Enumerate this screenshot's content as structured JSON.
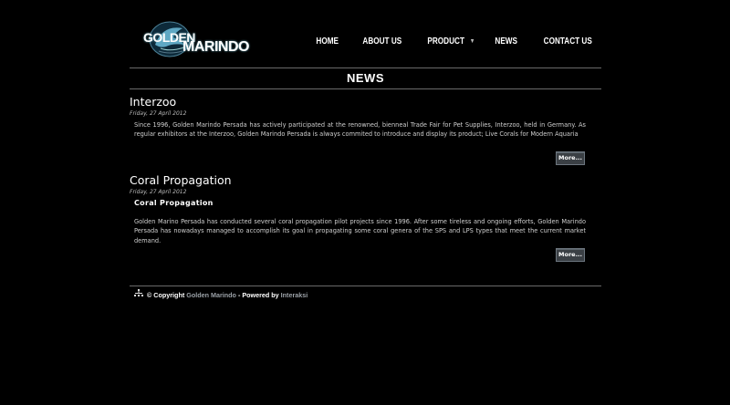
{
  "logo": {
    "line1": "GOLDEN",
    "line2": "MARINDO"
  },
  "nav": {
    "items": [
      {
        "label": "Home"
      },
      {
        "label": "About Us"
      },
      {
        "label": "Product",
        "has_dropdown": true
      },
      {
        "label": "News"
      },
      {
        "label": "Contact Us"
      }
    ]
  },
  "page": {
    "title": "NEWS"
  },
  "articles": [
    {
      "title": "Interzoo",
      "date": "Friday, 27 April 2012",
      "body": "Since 1996, Golden Marindo Persada has actively participated at the renowned, bienneal Trade Fair for Pet Supplies, Interzoo, held in Germany. As regular exhibitors at the Interzoo, Golden Marindo Persada is always commited to introduce and display its product; Live Corals for Modern Aquaria",
      "more_label": "More..."
    },
    {
      "title": "Coral Propagation",
      "date": "Friday, 27 April 2012",
      "subtitle": "Coral Propagation",
      "body": "Golden Marino Persada has conducted several coral propagation pilot projects since 1996. After some tireless and ongoing efforts, Golden Marindo Persada has nowadays managed to accomplish its goal in propagating some coral genera of the SPS and LPS types that meet the current market demand.",
      "more_label": "More..."
    }
  ],
  "footer": {
    "prefix": "© Copyright",
    "company_link": "Golden Marindo",
    "middle": "- Powered by",
    "powered_link": "Interaksi"
  },
  "colors": {
    "background": "#000000",
    "button": "#3a3f44",
    "rule": "#6a6a6a",
    "link": "#9aa0a6"
  }
}
